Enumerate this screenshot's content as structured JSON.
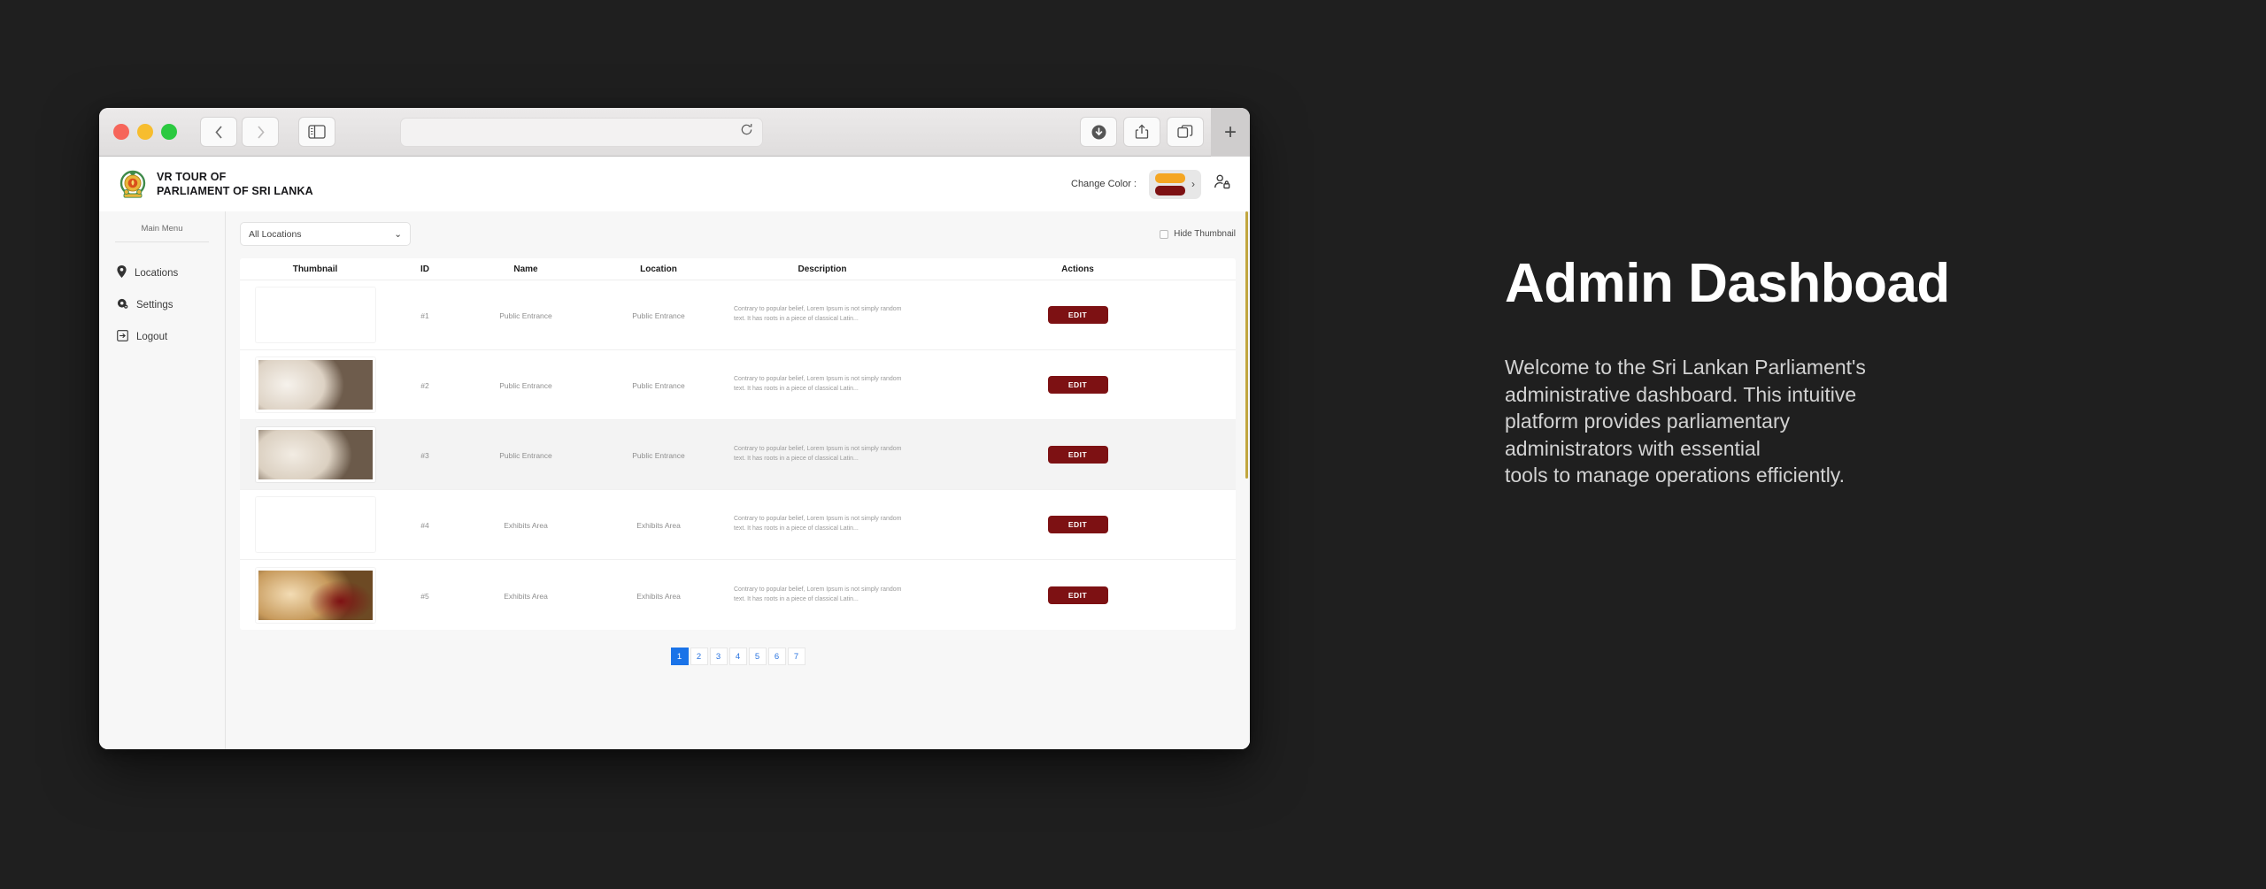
{
  "browser": {
    "traffic_lights": [
      "close",
      "minimize",
      "zoom"
    ],
    "back_label": "‹",
    "forward_label": "›",
    "sidebar_icon": "sidebar-icon",
    "url_value": "",
    "reload_icon": "reload-icon",
    "download_icon": "download-icon",
    "share_icon": "share-icon",
    "tabs_icon": "tab-overview-icon",
    "new_tab_label": "+"
  },
  "header": {
    "brand_line1": "VR TOUR OF",
    "brand_line2": "PARLIAMENT OF SRI LANKA",
    "change_color_label": "Change Color :",
    "swatch_top_color": "#f5a623",
    "swatch_bottom_color": "#7d1113",
    "color_next_label": "›",
    "account_icon": "user-lock-icon"
  },
  "sidebar": {
    "section_label": "Main Menu",
    "items": [
      {
        "label": "Locations",
        "icon": "map-pin-icon"
      },
      {
        "label": "Settings",
        "icon": "gear-icon"
      },
      {
        "label": "Logout",
        "icon": "logout-icon"
      }
    ]
  },
  "toolbar": {
    "location_filter_value": "All Locations",
    "location_filter_caret": "⌄",
    "hide_thumbnail_label": "Hide Thumbnail",
    "hide_thumbnail_checked": false
  },
  "table": {
    "columns": [
      "Thumbnail",
      "ID",
      "Name",
      "Location",
      "Description",
      "Actions"
    ],
    "description_text": "Contrary to popular belief, Lorem Ipsum is not simply random text. It has roots in a piece of classical Latin...",
    "edit_label": "EDIT",
    "rows": [
      {
        "id": "#1",
        "name": "Public Entrance",
        "location": "Public Entrance",
        "thumb": "corridor-light-1"
      },
      {
        "id": "#2",
        "name": "Public Entrance",
        "location": "Public Entrance",
        "thumb": "corridor-light-2"
      },
      {
        "id": "#3",
        "name": "Public Entrance",
        "location": "Public Entrance",
        "thumb": "corridor-light-3"
      },
      {
        "id": "#4",
        "name": "Exhibits Area",
        "location": "Exhibits Area",
        "thumb": "exhibit-gold-1"
      },
      {
        "id": "#5",
        "name": "Exhibits Area",
        "location": "Exhibits Area",
        "thumb": "exhibit-gold-2"
      }
    ]
  },
  "pagination": {
    "pages": [
      "1",
      "2",
      "3",
      "4",
      "5",
      "6",
      "7"
    ],
    "active": "1",
    "active_color": "#1a73e8"
  },
  "right_panel": {
    "title": "Admin Dashboad",
    "body": "Welcome to the Sri Lankan Parliament's\nadministrative dashboard. This intuitive\nplatform provides parliamentary\nadministrators with essential\ntools to manage operations efficiently."
  }
}
